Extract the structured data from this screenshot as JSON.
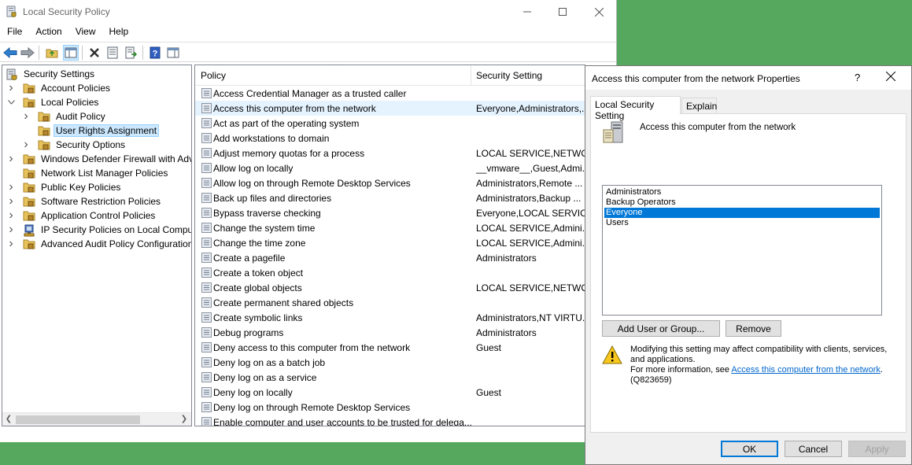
{
  "main_window": {
    "title": "Local Security Policy",
    "menu": [
      "File",
      "Action",
      "View",
      "Help"
    ]
  },
  "tree": {
    "items": [
      {
        "label": "Security Settings",
        "level": 0,
        "expander": "open-down",
        "icon": "shield-icon"
      },
      {
        "label": "Account Policies",
        "level": 1,
        "expander": "collapsed",
        "icon": "folder-icon"
      },
      {
        "label": "Local Policies",
        "level": 1,
        "expander": "expanded",
        "icon": "folder-icon"
      },
      {
        "label": "Audit Policy",
        "level": 2,
        "expander": "collapsed",
        "icon": "folder-icon"
      },
      {
        "label": "User Rights Assignment",
        "level": 2,
        "expander": "none",
        "icon": "folder-icon",
        "selected": true
      },
      {
        "label": "Security Options",
        "level": 2,
        "expander": "collapsed",
        "icon": "folder-icon"
      },
      {
        "label": "Windows Defender Firewall with Adva",
        "level": 1,
        "expander": "collapsed",
        "icon": "folder-icon"
      },
      {
        "label": "Network List Manager Policies",
        "level": 1,
        "expander": "none",
        "icon": "folder-icon"
      },
      {
        "label": "Public Key Policies",
        "level": 1,
        "expander": "collapsed",
        "icon": "folder-icon"
      },
      {
        "label": "Software Restriction Policies",
        "level": 1,
        "expander": "collapsed",
        "icon": "folder-icon"
      },
      {
        "label": "Application Control Policies",
        "level": 1,
        "expander": "collapsed",
        "icon": "folder-icon"
      },
      {
        "label": "IP Security Policies on Local Compute",
        "level": 1,
        "expander": "collapsed",
        "icon": "network-policy-icon"
      },
      {
        "label": "Advanced Audit Policy Configuration",
        "level": 1,
        "expander": "collapsed",
        "icon": "folder-icon"
      }
    ]
  },
  "list": {
    "col_policy": "Policy",
    "col_setting": "Security Setting",
    "rows": [
      {
        "name": "Access Credential Manager as a trusted caller",
        "value": ""
      },
      {
        "name": "Access this computer from the network",
        "value": "Everyone,Administrators,...",
        "hover": true
      },
      {
        "name": "Act as part of the operating system",
        "value": ""
      },
      {
        "name": "Add workstations to domain",
        "value": ""
      },
      {
        "name": "Adjust memory quotas for a process",
        "value": "LOCAL SERVICE,NETWO..."
      },
      {
        "name": "Allow log on locally",
        "value": "__vmware__,Guest,Admi..."
      },
      {
        "name": "Allow log on through Remote Desktop Services",
        "value": "Administrators,Remote ..."
      },
      {
        "name": "Back up files and directories",
        "value": "Administrators,Backup ..."
      },
      {
        "name": "Bypass traverse checking",
        "value": "Everyone,LOCAL SERVIC..."
      },
      {
        "name": "Change the system time",
        "value": "LOCAL SERVICE,Admini..."
      },
      {
        "name": "Change the time zone",
        "value": "LOCAL SERVICE,Admini..."
      },
      {
        "name": "Create a pagefile",
        "value": "Administrators"
      },
      {
        "name": "Create a token object",
        "value": ""
      },
      {
        "name": "Create global objects",
        "value": "LOCAL SERVICE,NETWO..."
      },
      {
        "name": "Create permanent shared objects",
        "value": ""
      },
      {
        "name": "Create symbolic links",
        "value": "Administrators,NT VIRTU..."
      },
      {
        "name": "Debug programs",
        "value": "Administrators"
      },
      {
        "name": "Deny access to this computer from the network",
        "value": "Guest"
      },
      {
        "name": "Deny log on as a batch job",
        "value": ""
      },
      {
        "name": "Deny log on as a service",
        "value": ""
      },
      {
        "name": "Deny log on locally",
        "value": "Guest"
      },
      {
        "name": "Deny log on through Remote Desktop Services",
        "value": ""
      },
      {
        "name": "Enable computer and user accounts to be trusted for delega...",
        "value": ""
      }
    ]
  },
  "dialog": {
    "title": "Access this computer from the network Properties",
    "help": "?",
    "tabs": [
      "Local Security Setting",
      "Explain"
    ],
    "policy_heading": "Access this computer from the network",
    "members": [
      {
        "name": "Administrators",
        "selected": false
      },
      {
        "name": "Backup Operators",
        "selected": false
      },
      {
        "name": "Everyone",
        "selected": true
      },
      {
        "name": "Users",
        "selected": false
      }
    ],
    "add_button": "Add User or Group...",
    "remove_button": "Remove",
    "warning_line1": "Modifying this setting may affect compatibility with clients, services, and applications.",
    "warning_line2_prefix": "For more information, see ",
    "warning_link": "Access this computer from the network",
    "warning_line2_suffix": ".",
    "warning_kb": "(Q823659)",
    "ok": "OK",
    "cancel": "Cancel",
    "apply": "Apply"
  },
  "colors": {
    "desktop": "#55a85e",
    "selection": "#0078d7",
    "tree_selection": "#cce8ff",
    "hover_row": "#e5f3ff",
    "link": "#0066cc"
  }
}
